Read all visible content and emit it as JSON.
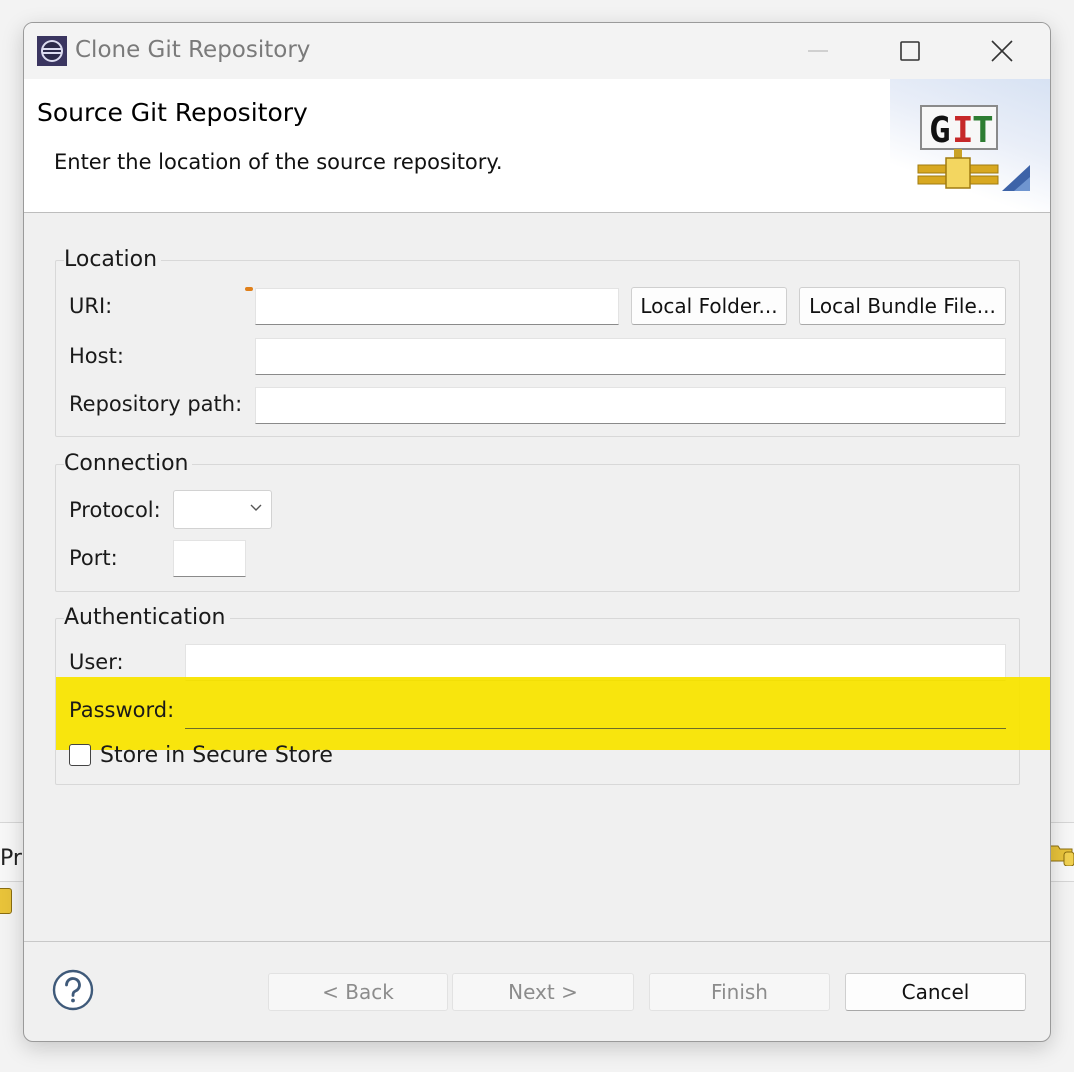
{
  "window": {
    "title": "Clone Git Repository"
  },
  "wizard": {
    "title": "Source Git Repository",
    "description": "Enter the location of the source repository.",
    "banner_icon": "git-logo",
    "banner_text": {
      "g": "G",
      "i": "I",
      "t": "T"
    }
  },
  "location": {
    "group_label": "Location",
    "uri_label": "URI:",
    "uri_value": "",
    "local_folder_button": "Local Folder...",
    "local_bundle_button": "Local Bundle File...",
    "host_label": "Host:",
    "host_value": "",
    "repo_path_label": "Repository path:",
    "repo_path_value": ""
  },
  "connection": {
    "group_label": "Connection",
    "protocol_label": "Protocol:",
    "protocol_value": "",
    "port_label": "Port:",
    "port_value": ""
  },
  "authentication": {
    "group_label": "Authentication",
    "user_label": "User:",
    "user_value": "",
    "password_label": "Password:",
    "password_value": "",
    "secure_store_label": "Store in Secure Store",
    "secure_store_checked": false
  },
  "buttons": {
    "back": "< Back",
    "next": "Next >",
    "finish": "Finish",
    "cancel": "Cancel"
  },
  "background": {
    "left_text": "Pr"
  },
  "colors": {
    "highlight": "#f8e400",
    "git_red": "#c62828",
    "git_green": "#2e7d32"
  }
}
